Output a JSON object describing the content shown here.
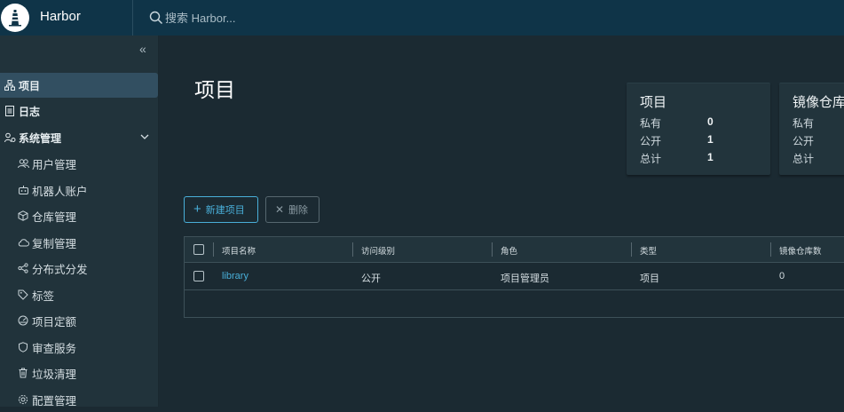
{
  "header": {
    "app_name": "Harbor",
    "search_placeholder": "搜索 Harbor..."
  },
  "sidebar": {
    "items": [
      {
        "label": "项目",
        "icon": "projects-icon"
      },
      {
        "label": "日志",
        "icon": "logs-icon"
      },
      {
        "label": "系统管理",
        "icon": "admin-icon"
      }
    ],
    "sub_items": [
      {
        "label": "用户管理",
        "icon": "users-icon"
      },
      {
        "label": "机器人账户",
        "icon": "robot-icon"
      },
      {
        "label": "仓库管理",
        "icon": "registry-icon"
      },
      {
        "label": "复制管理",
        "icon": "replication-icon"
      },
      {
        "label": "分布式分发",
        "icon": "distribution-icon"
      },
      {
        "label": "标签",
        "icon": "tag-icon"
      },
      {
        "label": "项目定额",
        "icon": "quota-icon"
      },
      {
        "label": "审查服务",
        "icon": "shield-icon"
      },
      {
        "label": "垃圾清理",
        "icon": "trash-icon"
      },
      {
        "label": "配置管理",
        "icon": "gear-icon"
      }
    ]
  },
  "main": {
    "title": "项目",
    "cards": [
      {
        "title": "项目",
        "rows": [
          {
            "label": "私有",
            "value": "0"
          },
          {
            "label": "公开",
            "value": "1"
          },
          {
            "label": "总计",
            "value": "1"
          }
        ]
      },
      {
        "title": "镜像仓库",
        "rows": [
          {
            "label": "私有",
            "value": ""
          },
          {
            "label": "公开",
            "value": ""
          },
          {
            "label": "总计",
            "value": ""
          }
        ]
      }
    ],
    "new_project_label": "新建项目",
    "delete_label": "删除",
    "columns": [
      "项目名称",
      "访问级别",
      "角色",
      "类型",
      "镜像仓库数"
    ],
    "rows": [
      {
        "name": "library",
        "access": "公开",
        "role": "项目管理员",
        "type": "项目",
        "repo_count": "0"
      }
    ]
  },
  "colors": {
    "header_bg": "#0f3448",
    "sidebar_bg": "#21333b",
    "content_bg": "#1b2a32",
    "accent": "#49afd9",
    "active_item": "#324f61"
  }
}
